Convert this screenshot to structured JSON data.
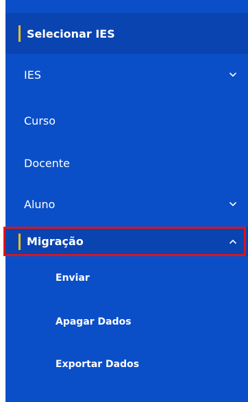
{
  "sidebar": {
    "selected_ies": "Selecionar IES",
    "items": [
      {
        "label": "IES",
        "chevron": "chevron-down-icon"
      },
      {
        "label": "Curso"
      },
      {
        "label": "Docente"
      },
      {
        "label": "Aluno",
        "chevron": "chevron-down-icon"
      },
      {
        "label": "Migração",
        "chevron": "chevron-up-icon",
        "expanded": true
      }
    ],
    "subitems": [
      {
        "label": "Enviar"
      },
      {
        "label": "Apagar Dados"
      },
      {
        "label": "Exportar Dados"
      }
    ]
  },
  "colors": {
    "sidebar_bg": "#0b4fc8",
    "active_bg": "#0a44b1",
    "indicator": "#f4c21b",
    "highlight": "#e0121b",
    "text": "#ffffff"
  }
}
